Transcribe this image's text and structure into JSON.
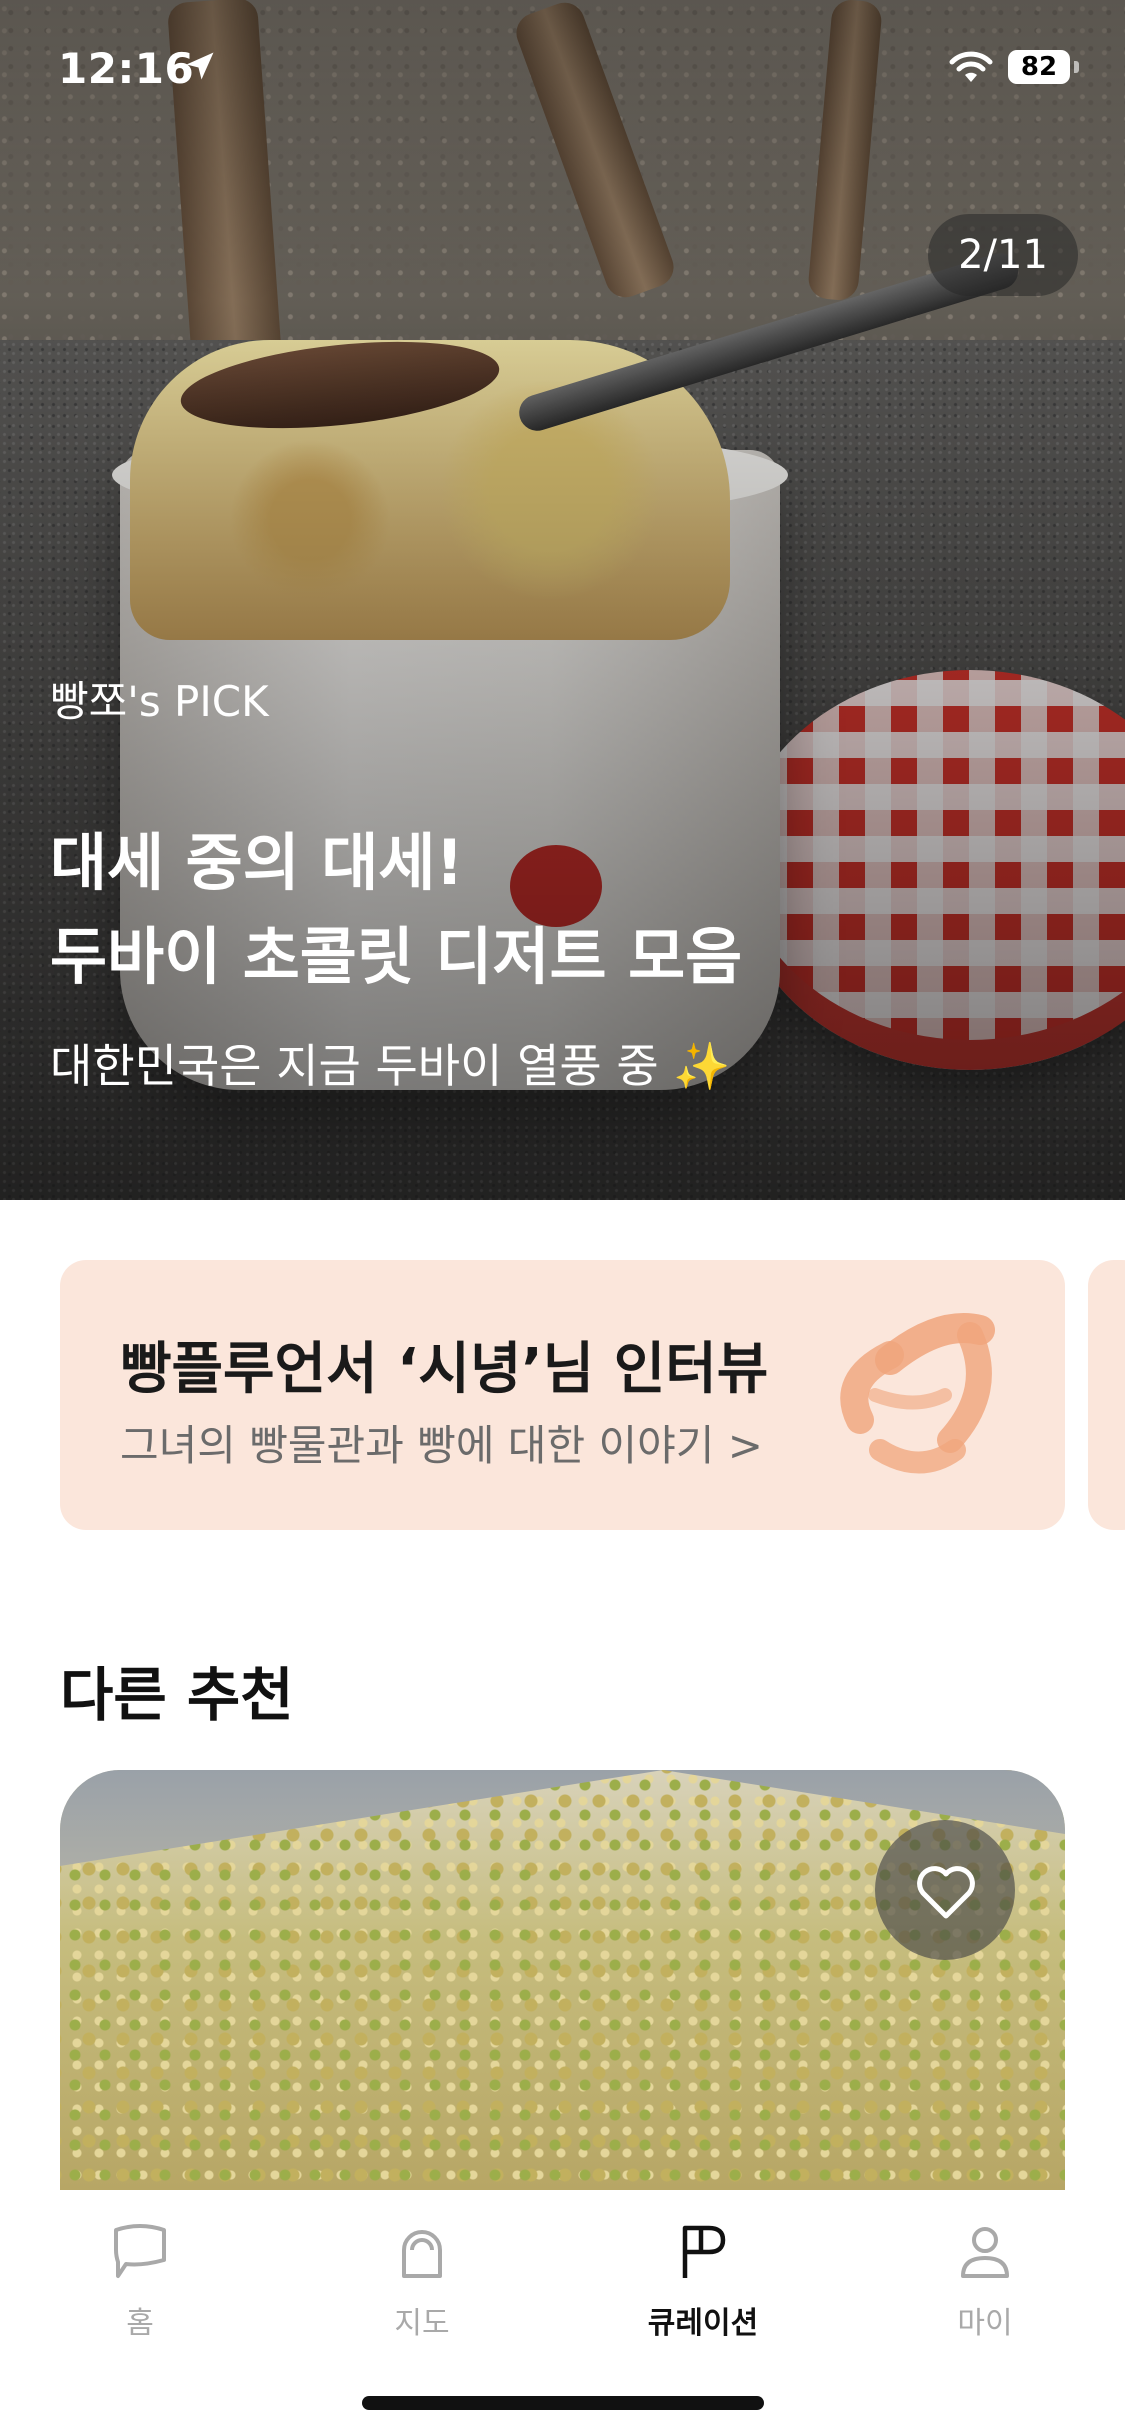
{
  "status_bar": {
    "time": "12:16",
    "battery": "82"
  },
  "hero": {
    "counter": "2/11",
    "pick_label": "빵쪼's PICK",
    "title_line1": "대세 중의 대세!",
    "title_line2": "두바이 초콜릿 디저트 모음",
    "subtitle": "대한민국은 지금 두바이 열풍 중 ✨"
  },
  "banner": {
    "title": "빵플루언서 ‘시녕’님 인터뷰",
    "subtitle": "그녀의 빵물관과 빵에 대한 이야기 >",
    "icon": "croissant-icon"
  },
  "section": {
    "title": "다른 추천"
  },
  "tabbar": {
    "active": "curation",
    "items": [
      {
        "id": "home",
        "label": "홈",
        "icon": "speech-bubble-icon"
      },
      {
        "id": "map",
        "label": "지도",
        "icon": "bread-icon"
      },
      {
        "id": "curation",
        "label": "큐레이션",
        "icon": "flag-icon"
      },
      {
        "id": "my",
        "label": "마이",
        "icon": "person-icon"
      }
    ]
  },
  "colors": {
    "banner_bg": "#fbe6db",
    "accent_text": "#111111",
    "inactive_tab": "#a9a9a9"
  }
}
